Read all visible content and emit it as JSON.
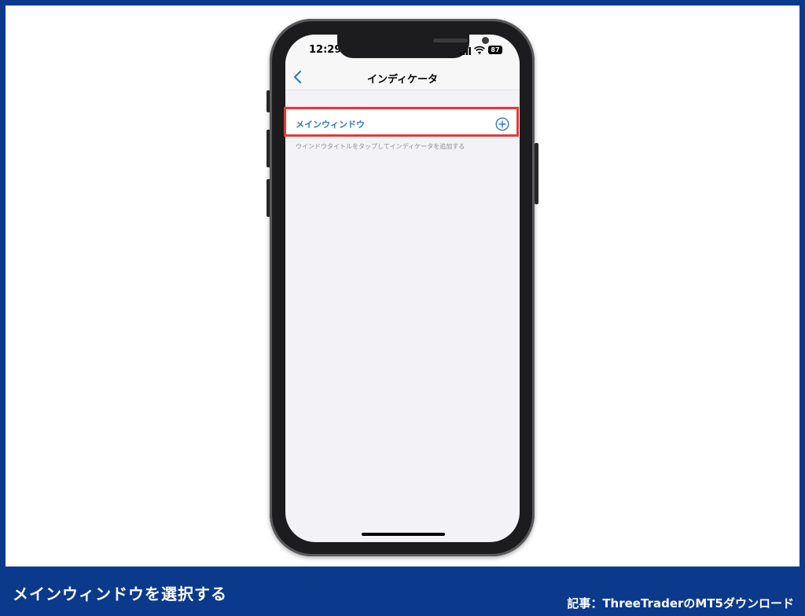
{
  "phone": {
    "status": {
      "time": "12:29",
      "battery": "87"
    },
    "nav": {
      "title": "インディケータ"
    },
    "row": {
      "label": "メインウィンドウ"
    },
    "hint": "ウインドウタイトルをタップしてインディケータを追加する"
  },
  "footer": {
    "caption": "メインウィンドウを選択する",
    "credit": "記事：ThreeTraderのMT5ダウンロード"
  },
  "colors": {
    "frame_blue": "#0b3a8c",
    "accent_blue": "#2e7ac6",
    "highlight_red": "#e53935"
  },
  "icons": [
    "chevron-left-icon",
    "plus-circle-icon",
    "signal-icon",
    "wifi-icon",
    "battery-icon"
  ]
}
